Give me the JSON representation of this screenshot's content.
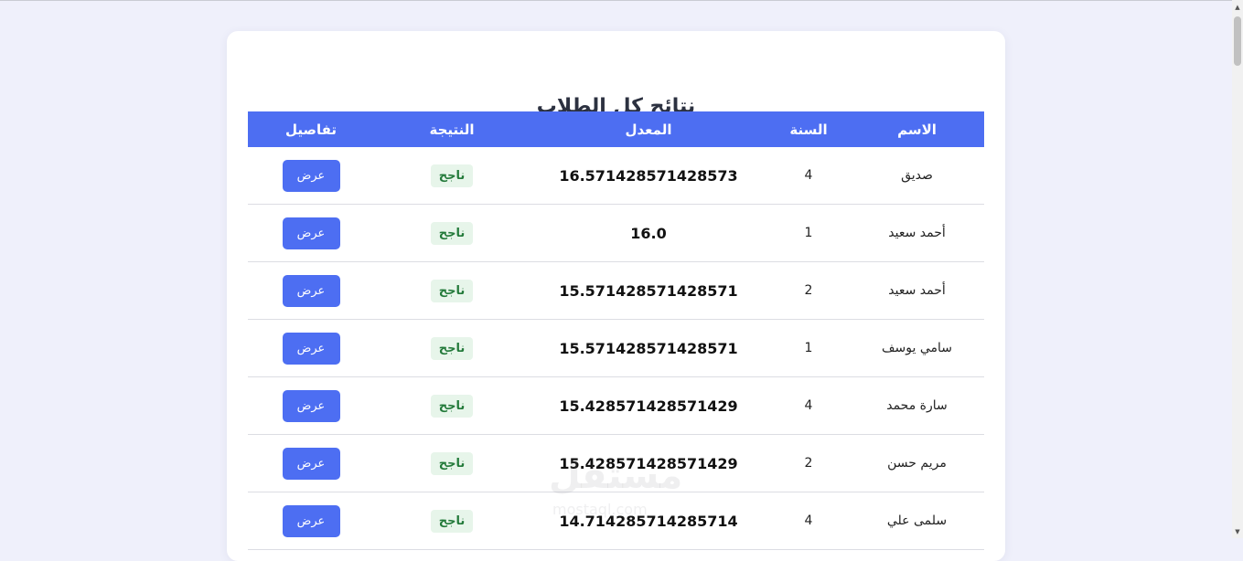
{
  "page": {
    "title": "نتائج كل الطلاب"
  },
  "table": {
    "headers": {
      "name": "الاسم",
      "year": "السنة",
      "average": "المعدل",
      "result": "النتيجة",
      "details": "تفاصيل"
    },
    "rows": [
      {
        "name": "صديق",
        "year": "4",
        "average": "16.571428571428573",
        "result": "ناجح",
        "action": "عرض"
      },
      {
        "name": "أحمد سعيد",
        "year": "1",
        "average": "16.0",
        "result": "ناجح",
        "action": "عرض"
      },
      {
        "name": "أحمد سعيد",
        "year": "2",
        "average": "15.571428571428571",
        "result": "ناجح",
        "action": "عرض"
      },
      {
        "name": "سامي يوسف",
        "year": "1",
        "average": "15.571428571428571",
        "result": "ناجح",
        "action": "عرض"
      },
      {
        "name": "سارة محمد",
        "year": "4",
        "average": "15.428571428571429",
        "result": "ناجح",
        "action": "عرض"
      },
      {
        "name": "مريم حسن",
        "year": "2",
        "average": "15.428571428571429",
        "result": "ناجح",
        "action": "عرض"
      },
      {
        "name": "سلمى علي",
        "year": "4",
        "average": "14.714285714285714",
        "result": "ناجح",
        "action": "عرض"
      }
    ]
  },
  "watermark": {
    "text": "مستقل",
    "sub": "mostaql.com"
  },
  "colors": {
    "accent": "#4d6ef2",
    "badge_bg": "#e7f5ea",
    "badge_text": "#237a3a",
    "page_bg": "#eff0fb"
  }
}
